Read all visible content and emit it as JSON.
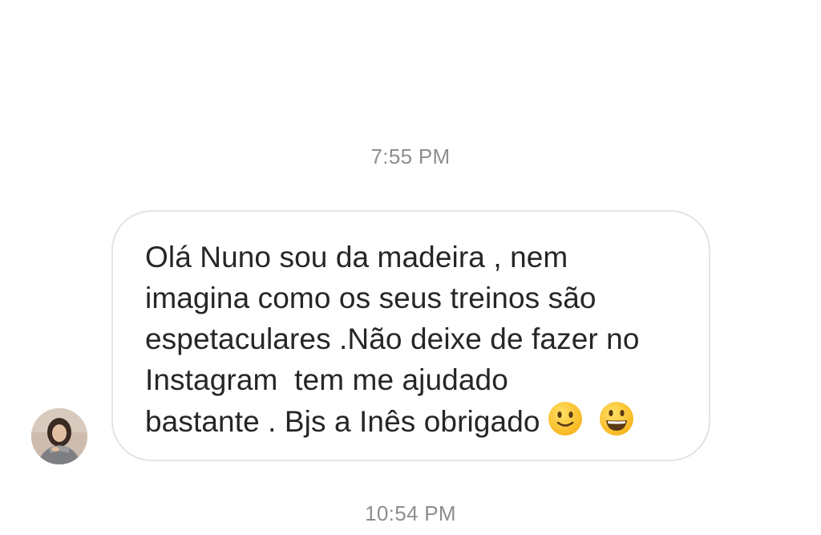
{
  "conversation": {
    "timestamp_first": "7:55 PM",
    "timestamp_second": "10:54 PM",
    "message": {
      "lines": [
        "Olá Nuno sou da madeira , nem",
        "imagina como os seus treinos são",
        "espetaculares .Não deixe de fazer no",
        "Instagram  tem me ajudado",
        "bastante . Bjs a Inês obrigado"
      ],
      "emojis": [
        "slightly-smiling-face",
        "grinning-face"
      ]
    },
    "sender": {
      "avatar": "profile-photo-avatar"
    }
  }
}
